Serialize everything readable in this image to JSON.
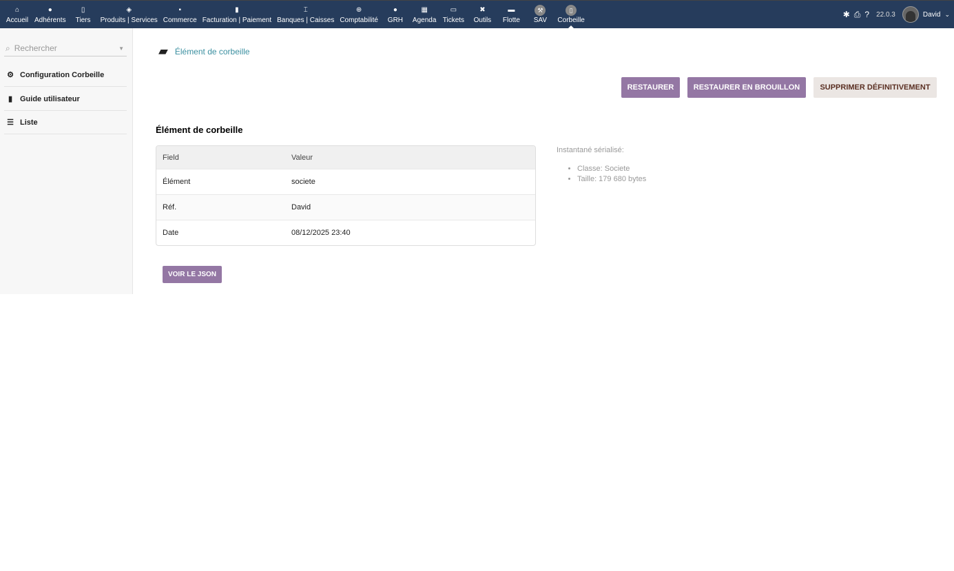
{
  "nav": [
    {
      "label": "Accueil",
      "icon": "home-icon",
      "glyph": "⌂"
    },
    {
      "label": "Adhérents",
      "icon": "user-icon",
      "glyph": "●"
    },
    {
      "label": "Tiers",
      "icon": "building-icon",
      "glyph": "▯"
    },
    {
      "label": "Produits | Services",
      "icon": "cube-icon",
      "glyph": "◈"
    },
    {
      "label": "Commerce",
      "icon": "briefcase-icon",
      "glyph": "▪"
    },
    {
      "label": "Facturation | Paiement",
      "icon": "invoice-icon",
      "glyph": "▮"
    },
    {
      "label": "Banques | Caisses",
      "icon": "bank-icon",
      "glyph": "⌶"
    },
    {
      "label": "Comptabilité",
      "icon": "search-dollar-icon",
      "glyph": "⊕"
    },
    {
      "label": "GRH",
      "icon": "user-tie-icon",
      "glyph": "●"
    },
    {
      "label": "Agenda",
      "icon": "calendar-icon",
      "glyph": "▦"
    },
    {
      "label": "Tickets",
      "icon": "ticket-icon",
      "glyph": "▭"
    },
    {
      "label": "Outils",
      "icon": "tools-icon",
      "glyph": "✖"
    },
    {
      "label": "Flotte",
      "icon": "car-icon",
      "glyph": "▬"
    },
    {
      "label": "SAV",
      "icon": "wrench-icon",
      "glyph": "⚒"
    },
    {
      "label": "Corbeille",
      "icon": "trash-icon",
      "glyph": "▯"
    }
  ],
  "header": {
    "version": "22.0.3",
    "user": "David"
  },
  "sidebar": {
    "search_placeholder": "Rechercher",
    "items": [
      {
        "label": "Configuration Corbeille"
      },
      {
        "label": "Guide utilisateur"
      },
      {
        "label": "Liste"
      }
    ]
  },
  "breadcrumb": "Élément de corbeille",
  "buttons": {
    "restore": "RESTAURER",
    "restore_draft": "RESTAURER EN BROUILLON",
    "delete": "SUPPRIMER DÉFINITIVEMENT",
    "json": "VOIR LE JSON"
  },
  "section_title": "Élément de corbeille",
  "table": {
    "headers": [
      "Field",
      "Valeur"
    ],
    "rows": [
      [
        "Élément",
        "societe"
      ],
      [
        "Réf.",
        "David"
      ],
      [
        "Date",
        "08/12/2025 23:40"
      ]
    ]
  },
  "snapshot": {
    "title": "Instantané sérialisé:",
    "items": [
      "Classe: Societe",
      "Taille: 179 680 bytes"
    ]
  },
  "colors": {
    "topbar": "#263c5c",
    "primary_button": "#9477a4",
    "link": "#3b8fa0"
  }
}
